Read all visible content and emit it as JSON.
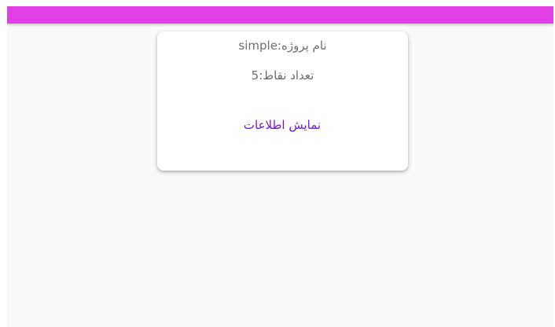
{
  "card": {
    "project_name_label": "نام پروژه:",
    "project_name_value": "simple",
    "points_count_label": "تعداد نقاط:",
    "points_count_value": "5",
    "show_info_button": "نمایش اطلاعات"
  },
  "colors": {
    "app_bar": "#e040e6",
    "button_text": "#6a1bd1",
    "body_text": "#6f6f6f",
    "background": "#fafafa"
  }
}
